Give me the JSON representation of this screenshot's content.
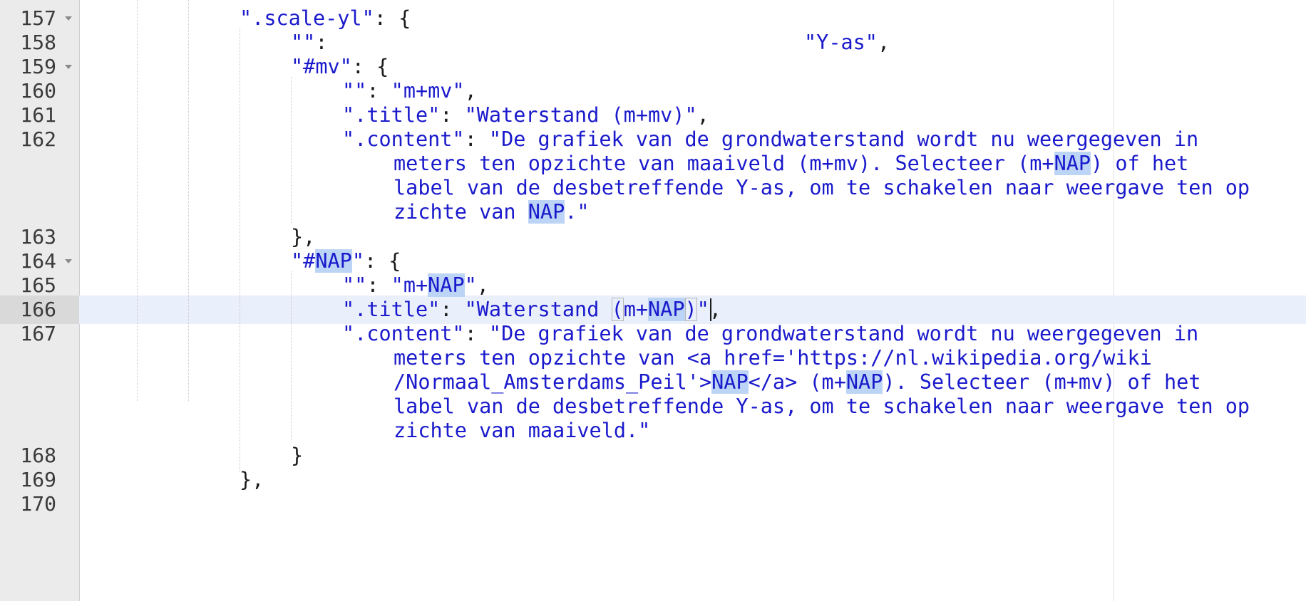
{
  "editor": {
    "line_numbers": [
      "157",
      "158",
      "159",
      "160",
      "161",
      "162",
      "163",
      "164",
      "165",
      "166",
      "167",
      "168",
      "169",
      "170"
    ],
    "lines": {
      "l157": {
        "key": "\".scale-yl\"",
        "punct": ": {"
      },
      "l158": {
        "key": "\"\"",
        "colon": ":",
        "value": "\"Y-as\"",
        "comma": ","
      },
      "l159": {
        "key": "\"#mv\"",
        "punct": ": {"
      },
      "l160": {
        "key": "\"\"",
        "colon": ": ",
        "value": "\"m+mv\"",
        "comma": ","
      },
      "l161": {
        "key": "\".title\"",
        "colon": ": ",
        "value": "\"Waterstand (m+mv)\"",
        "comma": ","
      },
      "l162": {
        "key": "\".content\"",
        "colon": ": ",
        "w1": "\"De grafiek van de grondwaterstand wordt nu weergegeven in",
        "w2a": "meters ten opzichte van maaiveld (m+mv). Selecteer (m+",
        "w2hl": "NAP",
        "w2b": ") of het",
        "w3": "label van de desbetreffende Y-as, om te schakelen naar weergave ten op",
        "w4a": "zichte van ",
        "w4hl": "NAP",
        "w4b": ".\""
      },
      "l163": {
        "punct": "},"
      },
      "l164": {
        "q1": "\"#",
        "hl": "NAP",
        "q2": "\"",
        "punct": ": {"
      },
      "l165": {
        "key": "\"\"",
        "colon": ": ",
        "v1": "\"m+",
        "hl": "NAP",
        "v2": "\"",
        "comma": ","
      },
      "l166": {
        "key": "\".title\"",
        "colon": ": ",
        "v1": "\"Waterstand ",
        "open": "(",
        "v2": "m+",
        "hl": "NAP",
        "close": ")",
        "v3": "\"",
        "comma": ","
      },
      "l167": {
        "key": "\".content\"",
        "colon": ": ",
        "w1": "\"De grafiek van de grondwaterstand wordt nu weergegeven in",
        "w2": "meters ten opzichte van <a href='https://nl.wikipedia.org/wiki",
        "w3a": "/Normaal_Amsterdams_Peil'>",
        "w3hl1": "NAP",
        "w3b": "</a> (m+",
        "w3hl2": "NAP",
        "w3c": "). Selecteer (m+mv) of het",
        "w4": "label van de desbetreffende Y-as, om te schakelen naar weergave ten op",
        "w5": "zichte van maaiveld.\""
      },
      "l168": {
        "punct": "}"
      },
      "l169": {
        "punct": "},"
      }
    }
  },
  "colors": {
    "string": "#1a1acc",
    "highlight": "#bcd4f5",
    "active_line": "#e9effb",
    "gutter": "#ebebeb"
  }
}
